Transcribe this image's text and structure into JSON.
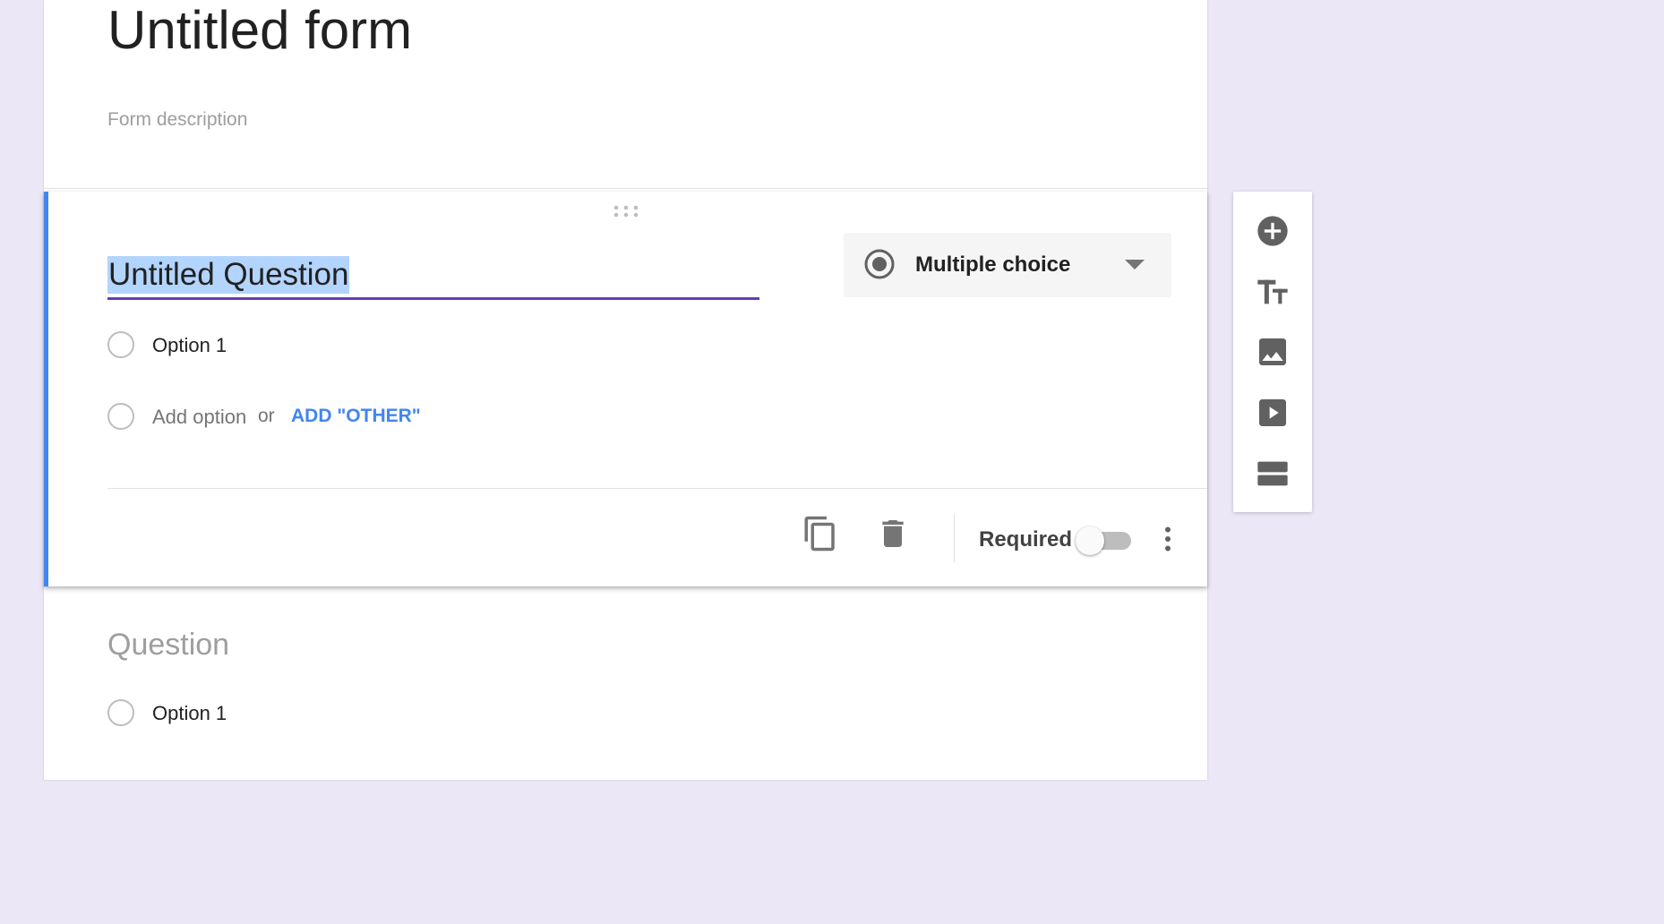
{
  "form": {
    "title": "Untitled form",
    "description_placeholder": "Form description"
  },
  "active_question": {
    "title": "Untitled Question",
    "type": {
      "icon": "radio-button-checked-icon",
      "label": "Multiple choice",
      "dropdown_icon": "arrow-drop-down-icon"
    },
    "options": [
      {
        "label": "Option 1"
      }
    ],
    "add_option": {
      "label": "Add option",
      "or": "or",
      "add_other": "ADD \"OTHER\""
    },
    "footer": {
      "duplicate_icon": "copy-icon",
      "delete_icon": "trash-icon",
      "required_label": "Required",
      "required_on": false,
      "more_icon": "more-vert-icon"
    }
  },
  "next_question": {
    "title_placeholder": "Question",
    "options": [
      {
        "label": "Option 1"
      }
    ]
  },
  "toolbar": {
    "tools": [
      {
        "icon": "add-circle-icon",
        "label": "Add question"
      },
      {
        "icon": "title-icon",
        "label": "Add title and description"
      },
      {
        "icon": "image-icon",
        "label": "Add image"
      },
      {
        "icon": "video-icon",
        "label": "Add video"
      },
      {
        "icon": "section-icon",
        "label": "Add section"
      }
    ]
  },
  "colors": {
    "background": "#ece7f6",
    "accent_blue": "#4285f4",
    "underline_purple": "#673ab7",
    "selection": "#b3d4fc"
  }
}
